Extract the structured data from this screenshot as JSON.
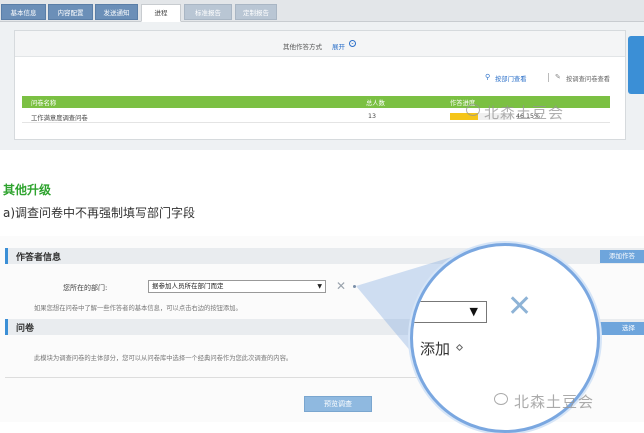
{
  "top_tabs": [
    "基本信息",
    "内容配置",
    "发送通知",
    "进程",
    "标准报告",
    "定制报告"
  ],
  "top_panel": {
    "other_mode_label": "其他作答方式",
    "expand_link": "展开",
    "view_by_dept": "按部门查看",
    "view_by_survey": "按调查问卷查看",
    "table_headers": {
      "name": "问卷名称",
      "total": "总人数",
      "progress": "作答进度"
    },
    "table_row": {
      "name": "工作满意度调查问卷",
      "total": "13",
      "progress_label": "46.15%",
      "progress_fraction": 0.4615
    },
    "accent_green": "#7bc043",
    "progress_color": "#f5c518"
  },
  "watermark": "北森土豆会",
  "section": {
    "heading": "其他升级",
    "description": "a)调查问卷中不再强制填写部门字段"
  },
  "bottom_form": {
    "respondent_section_title": "作答者信息",
    "add_button": "添加作答",
    "dept_label": "您所在的部门:",
    "dept_select_value": "据参加人员所在部门而定",
    "hint_respondent": "如果您想在问卷中了解一些作答者的基本信息，可以点击右边的按钮添加。",
    "questionnaire_section_title": "问卷",
    "select_button": "选择",
    "hint_questionnaire": "此模块为调查问卷的主体部分，您可以从问卷库中选择一个经典问卷作为您此次调查的内容。",
    "preview_button": "预览调查",
    "magnified_add": "添加"
  }
}
